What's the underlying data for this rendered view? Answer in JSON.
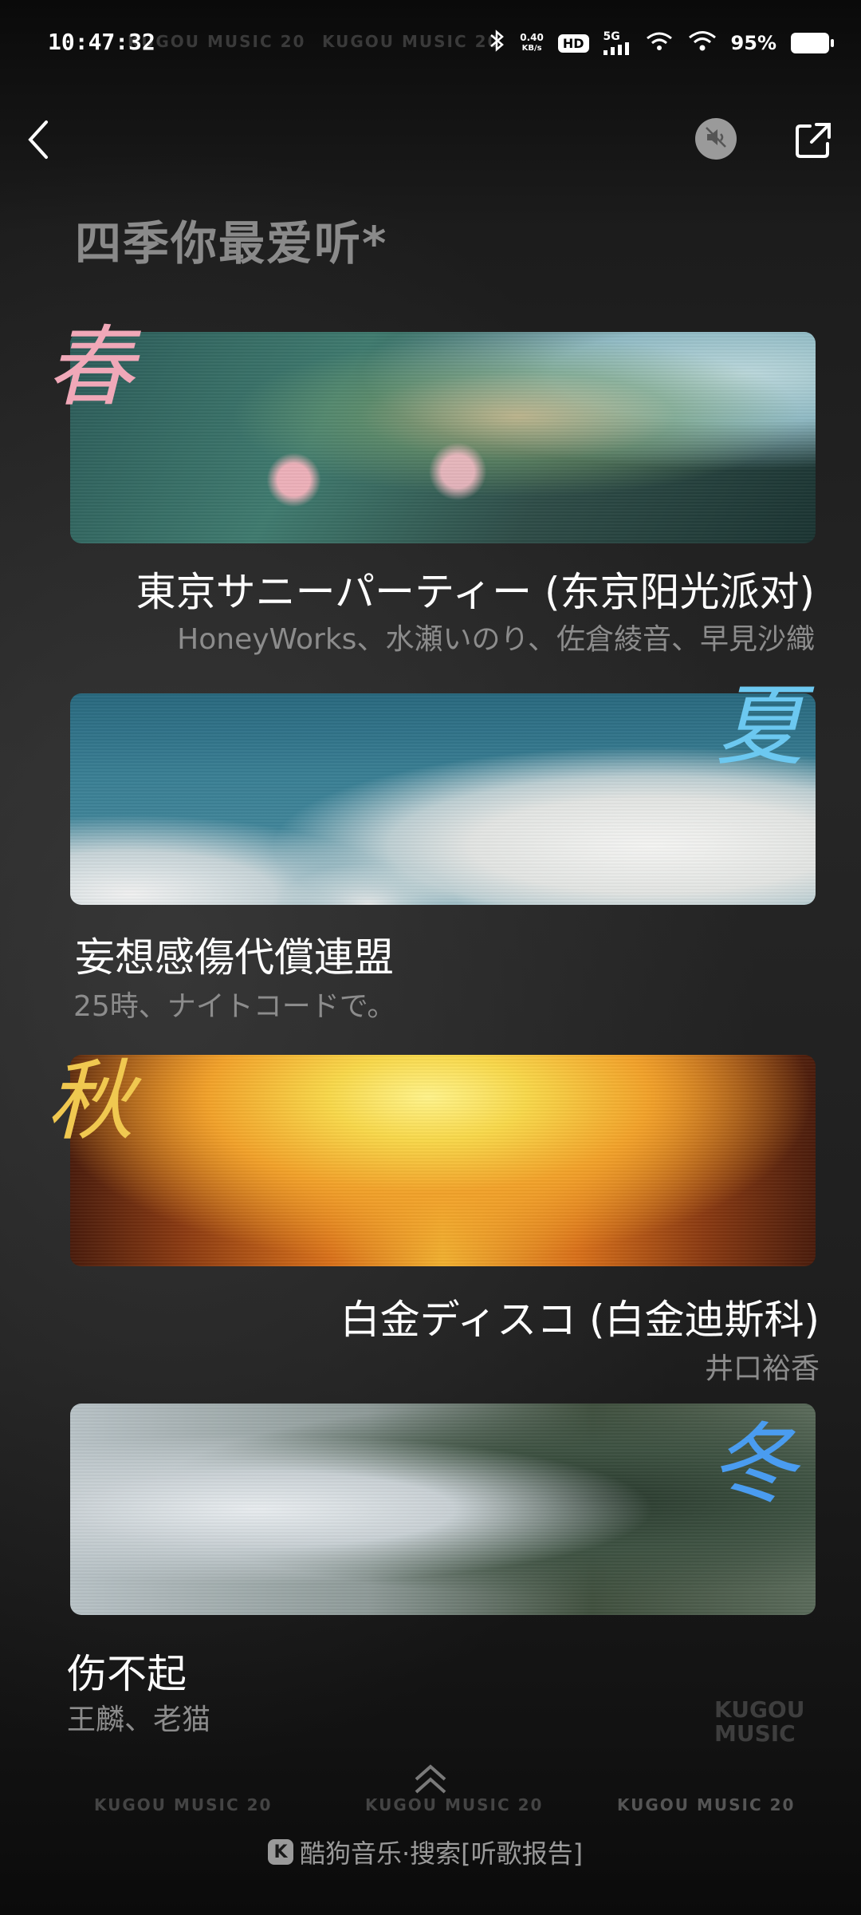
{
  "status_bar": {
    "time": "10:47:32",
    "net_speed_value": "0.40",
    "net_speed_unit": "KB/s",
    "hd": "HD",
    "signal": "5G",
    "battery_percent": "95%",
    "marquee_left": "KUGOU MUSIC 20",
    "marquee_center": "KUGOU MUSIC 20"
  },
  "header": {
    "title": "四季你最爱听*"
  },
  "seasons": [
    {
      "season_char": "春",
      "song_title": "東京サニーパーティー (东京阳光派对)",
      "artists": "HoneyWorks、水瀬いのり、佐倉綾音、早見沙織",
      "char_color": "#f0a8b8"
    },
    {
      "season_char": "夏",
      "song_title": "妄想感傷代償連盟",
      "artists": "25時、ナイトコードで。",
      "char_color": "#6cc8f0"
    },
    {
      "season_char": "秋",
      "song_title": "白金ディスコ (白金迪斯科)",
      "artists": "井口裕香",
      "char_color": "#f0c850"
    },
    {
      "season_char": "冬",
      "song_title": "伤不起",
      "artists": "王麟、老猫",
      "char_color": "#4a9cf0"
    }
  ],
  "watermark": {
    "line1": "KUGOU",
    "line2": "MUSIC"
  },
  "footer": {
    "strip_items": [
      "KUGOU MUSIC 20",
      "KUGOU MUSIC 20",
      "KUGOU MUSIC 20"
    ],
    "brand_logo": "K",
    "brand_text": "酷狗音乐·搜索[听歌报告]"
  },
  "icons": {
    "back": "chevron-left-icon",
    "mute": "speaker-muted-icon",
    "share": "share-icon",
    "up": "double-chevron-up-icon"
  }
}
